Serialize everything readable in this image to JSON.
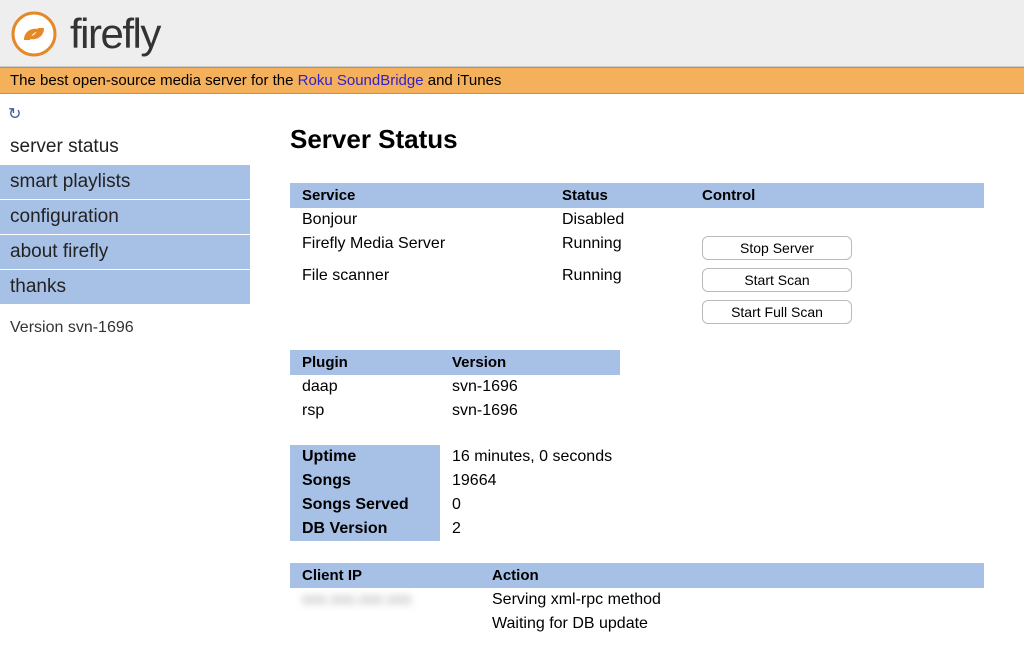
{
  "brand": {
    "name": "firefly"
  },
  "tagline": {
    "prefix": "The best open-source media server for the ",
    "link_text": "Roku SoundBridge",
    "suffix": " and iTunes"
  },
  "sidebar": {
    "items": [
      {
        "label": "server status",
        "active": true
      },
      {
        "label": "smart playlists",
        "active": false
      },
      {
        "label": "configuration",
        "active": false
      },
      {
        "label": "about firefly",
        "active": false
      },
      {
        "label": "thanks",
        "active": false
      }
    ],
    "version": "Version svn-1696"
  },
  "page": {
    "title": "Server Status"
  },
  "services": {
    "headers": {
      "service": "Service",
      "status": "Status",
      "control": "Control"
    },
    "rows": [
      {
        "name": "Bonjour",
        "status": "Disabled",
        "btn": ""
      },
      {
        "name": "Firefly Media Server",
        "status": "Running",
        "btn": "Stop Server"
      },
      {
        "name": "File scanner",
        "status": "Running",
        "btn": "Start Scan"
      }
    ],
    "extra_btn": "Start Full Scan"
  },
  "plugins": {
    "headers": {
      "plugin": "Plugin",
      "version": "Version"
    },
    "rows": [
      {
        "name": "daap",
        "version": "svn-1696"
      },
      {
        "name": "rsp",
        "version": "svn-1696"
      }
    ]
  },
  "stats": {
    "uptime_label": "Uptime",
    "uptime_value": "16 minutes, 0 seconds",
    "songs_label": "Songs",
    "songs_value": "19664",
    "served_label": "Songs Served",
    "served_value": "0",
    "dbv_label": "DB Version",
    "dbv_value": "2"
  },
  "clients": {
    "headers": {
      "ip": "Client IP",
      "action": "Action"
    },
    "rows": [
      {
        "ip": "xxx.xxx.xxx.xxx",
        "action": "Serving xml-rpc method"
      },
      {
        "ip": "",
        "action": "Waiting for DB update"
      }
    ]
  }
}
